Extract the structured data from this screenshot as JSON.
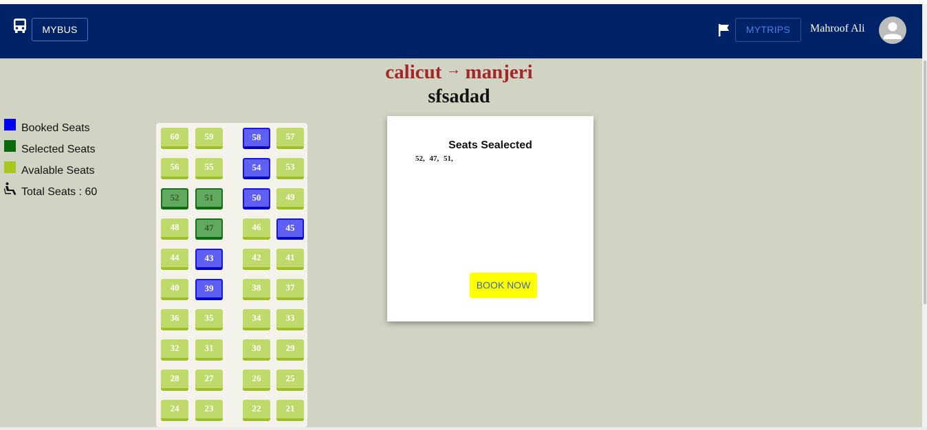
{
  "header": {
    "brand_label": "MYBUS",
    "trips_label": "MYTRIPS",
    "user_name": "Mahroof Ali"
  },
  "route": {
    "from": "calicut",
    "arrow": "→",
    "to": "manjeri",
    "bus_name": "sfsadad"
  },
  "legend": {
    "booked": "Booked Seats",
    "selected": "Selected Seats",
    "available": "Avalable Seats",
    "total": "Total Seats : 60"
  },
  "colors": {
    "appbar": "#002266",
    "booked": "#0000ee",
    "selected": "#0b6a0b",
    "available": "#a8c81e",
    "route_text": "#a3262b",
    "book_button": "#ffff00"
  },
  "seat_rows": [
    [
      {
        "n": "60",
        "s": "available"
      },
      {
        "n": "59",
        "s": "available"
      },
      {
        "n": "58",
        "s": "booked"
      },
      {
        "n": "57",
        "s": "available"
      }
    ],
    [
      {
        "n": "56",
        "s": "available"
      },
      {
        "n": "55",
        "s": "available"
      },
      {
        "n": "54",
        "s": "booked"
      },
      {
        "n": "53",
        "s": "available"
      }
    ],
    [
      {
        "n": "52",
        "s": "selected"
      },
      {
        "n": "51",
        "s": "selected"
      },
      {
        "n": "50",
        "s": "booked"
      },
      {
        "n": "49",
        "s": "available"
      }
    ],
    [
      {
        "n": "48",
        "s": "available"
      },
      {
        "n": "47",
        "s": "selected"
      },
      {
        "n": "46",
        "s": "available"
      },
      {
        "n": "45",
        "s": "booked"
      }
    ],
    [
      {
        "n": "44",
        "s": "available"
      },
      {
        "n": "43",
        "s": "booked"
      },
      {
        "n": "42",
        "s": "available"
      },
      {
        "n": "41",
        "s": "available"
      }
    ],
    [
      {
        "n": "40",
        "s": "available"
      },
      {
        "n": "39",
        "s": "booked"
      },
      {
        "n": "38",
        "s": "available"
      },
      {
        "n": "37",
        "s": "available"
      }
    ],
    [
      {
        "n": "36",
        "s": "available"
      },
      {
        "n": "35",
        "s": "available"
      },
      {
        "n": "34",
        "s": "available"
      },
      {
        "n": "33",
        "s": "available"
      }
    ],
    [
      {
        "n": "32",
        "s": "available"
      },
      {
        "n": "31",
        "s": "available"
      },
      {
        "n": "30",
        "s": "available"
      },
      {
        "n": "29",
        "s": "available"
      }
    ],
    [
      {
        "n": "28",
        "s": "available"
      },
      {
        "n": "27",
        "s": "available"
      },
      {
        "n": "26",
        "s": "available"
      },
      {
        "n": "25",
        "s": "available"
      }
    ],
    [
      {
        "n": "24",
        "s": "available"
      },
      {
        "n": "23",
        "s": "available"
      },
      {
        "n": "22",
        "s": "available"
      },
      {
        "n": "21",
        "s": "available"
      }
    ]
  ],
  "summary": {
    "title": "Seats Sealected",
    "selected_seats": "52,  47,  51,",
    "book_label": "BOOK NOW"
  }
}
